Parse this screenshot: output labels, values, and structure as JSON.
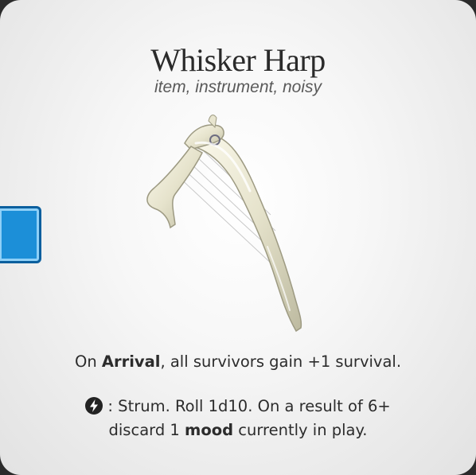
{
  "card": {
    "title": "Whisker Harp",
    "keywords": "item, instrument, noisy",
    "rule1": {
      "prefix": "On ",
      "bold": "Arrival",
      "suffix": ", all survivors gain +1 survival."
    },
    "rule2": {
      "icon": "activation-bolt-icon",
      "line1": " : Strum. Roll 1d10. On a result of 6+",
      "line2_prefix": "discard 1 ",
      "line2_bold": "mood",
      "line2_suffix": " currently in play."
    }
  },
  "colors": {
    "marker": "#1c8fd8",
    "text": "#2c2c2c"
  }
}
